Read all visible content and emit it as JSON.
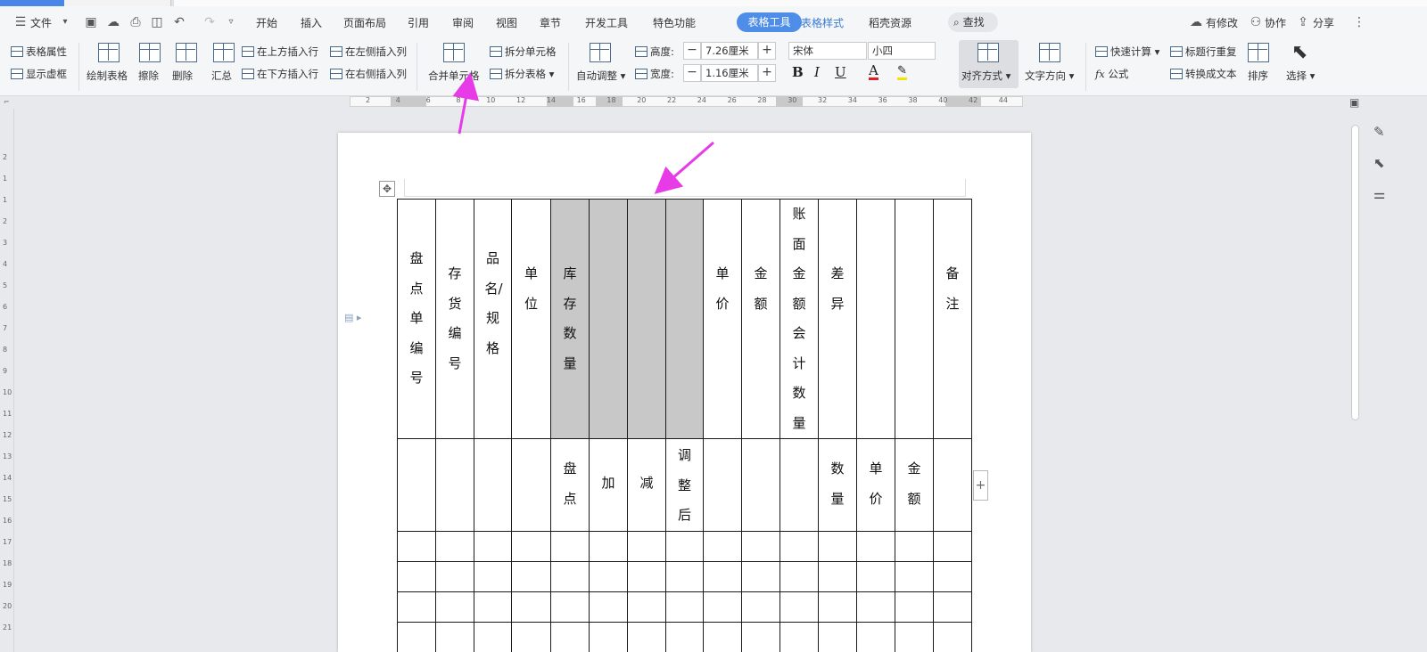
{
  "menu": {
    "file": "文件",
    "tabs": [
      "开始",
      "插入",
      "页面布局",
      "引用",
      "审阅",
      "视图",
      "章节",
      "开发工具",
      "特色功能"
    ],
    "active_tab": "表格工具",
    "style_tab": "表格样式",
    "resource_tab": "稻壳资源",
    "search": "查找",
    "modified": "有修改",
    "collab": "协作",
    "share": "分享"
  },
  "ribbon": {
    "table_props": "表格属性",
    "show_grid": "显示虚框",
    "draw_table": "绘制表格",
    "erase": "擦除",
    "delete": "删除",
    "summary": "汇总",
    "insert_above": "在上方插入行",
    "insert_below": "在下方插入行",
    "insert_left": "在左侧插入列",
    "insert_right": "在右侧插入列",
    "merge_cells": "合并单元格",
    "split_cells": "拆分单元格",
    "split_table": "拆分表格",
    "auto_adjust": "自动调整",
    "height_label": "高度:",
    "height_value": "7.26厘米",
    "width_label": "宽度:",
    "width_value": "1.16厘米",
    "font_name": "宋体",
    "font_size": "小四",
    "align": "对齐方式",
    "text_dir": "文字方向",
    "quick_calc": "快速计算",
    "repeat_header": "标题行重复",
    "formula": "公式",
    "to_text": "转换成文本",
    "sort": "排序",
    "select": "选择"
  },
  "ruler_numbers": [
    "2",
    "4",
    "6",
    "8",
    "10",
    "12",
    "14",
    "16",
    "18",
    "20",
    "22",
    "24",
    "26",
    "28",
    "30",
    "32",
    "34",
    "36",
    "38",
    "40",
    "42",
    "44"
  ],
  "vruler_numbers": [
    "2",
    "1",
    "1",
    "2",
    "3",
    "4",
    "5",
    "6",
    "7",
    "8",
    "9",
    "10",
    "11",
    "12",
    "13",
    "14",
    "15",
    "16",
    "17",
    "18",
    "19",
    "20",
    "21"
  ],
  "table": {
    "header_row1": [
      "盘点单编号",
      "存货编号",
      "品名/规格",
      "单位",
      "库存数量",
      "",
      "",
      "",
      "单价",
      "金额",
      "账面金额会计数量",
      "差异",
      "",
      "",
      "备注"
    ],
    "header_row2": [
      "",
      "",
      "",
      "",
      "盘点",
      "加",
      "减",
      "调整后",
      "",
      "",
      "",
      "数量",
      "单价",
      "金额",
      ""
    ],
    "empty_rows": 4
  },
  "colors": {
    "accent": "#4f8ee8",
    "arrow": "#e63be6",
    "selected_cell": "#c8c8c8"
  }
}
